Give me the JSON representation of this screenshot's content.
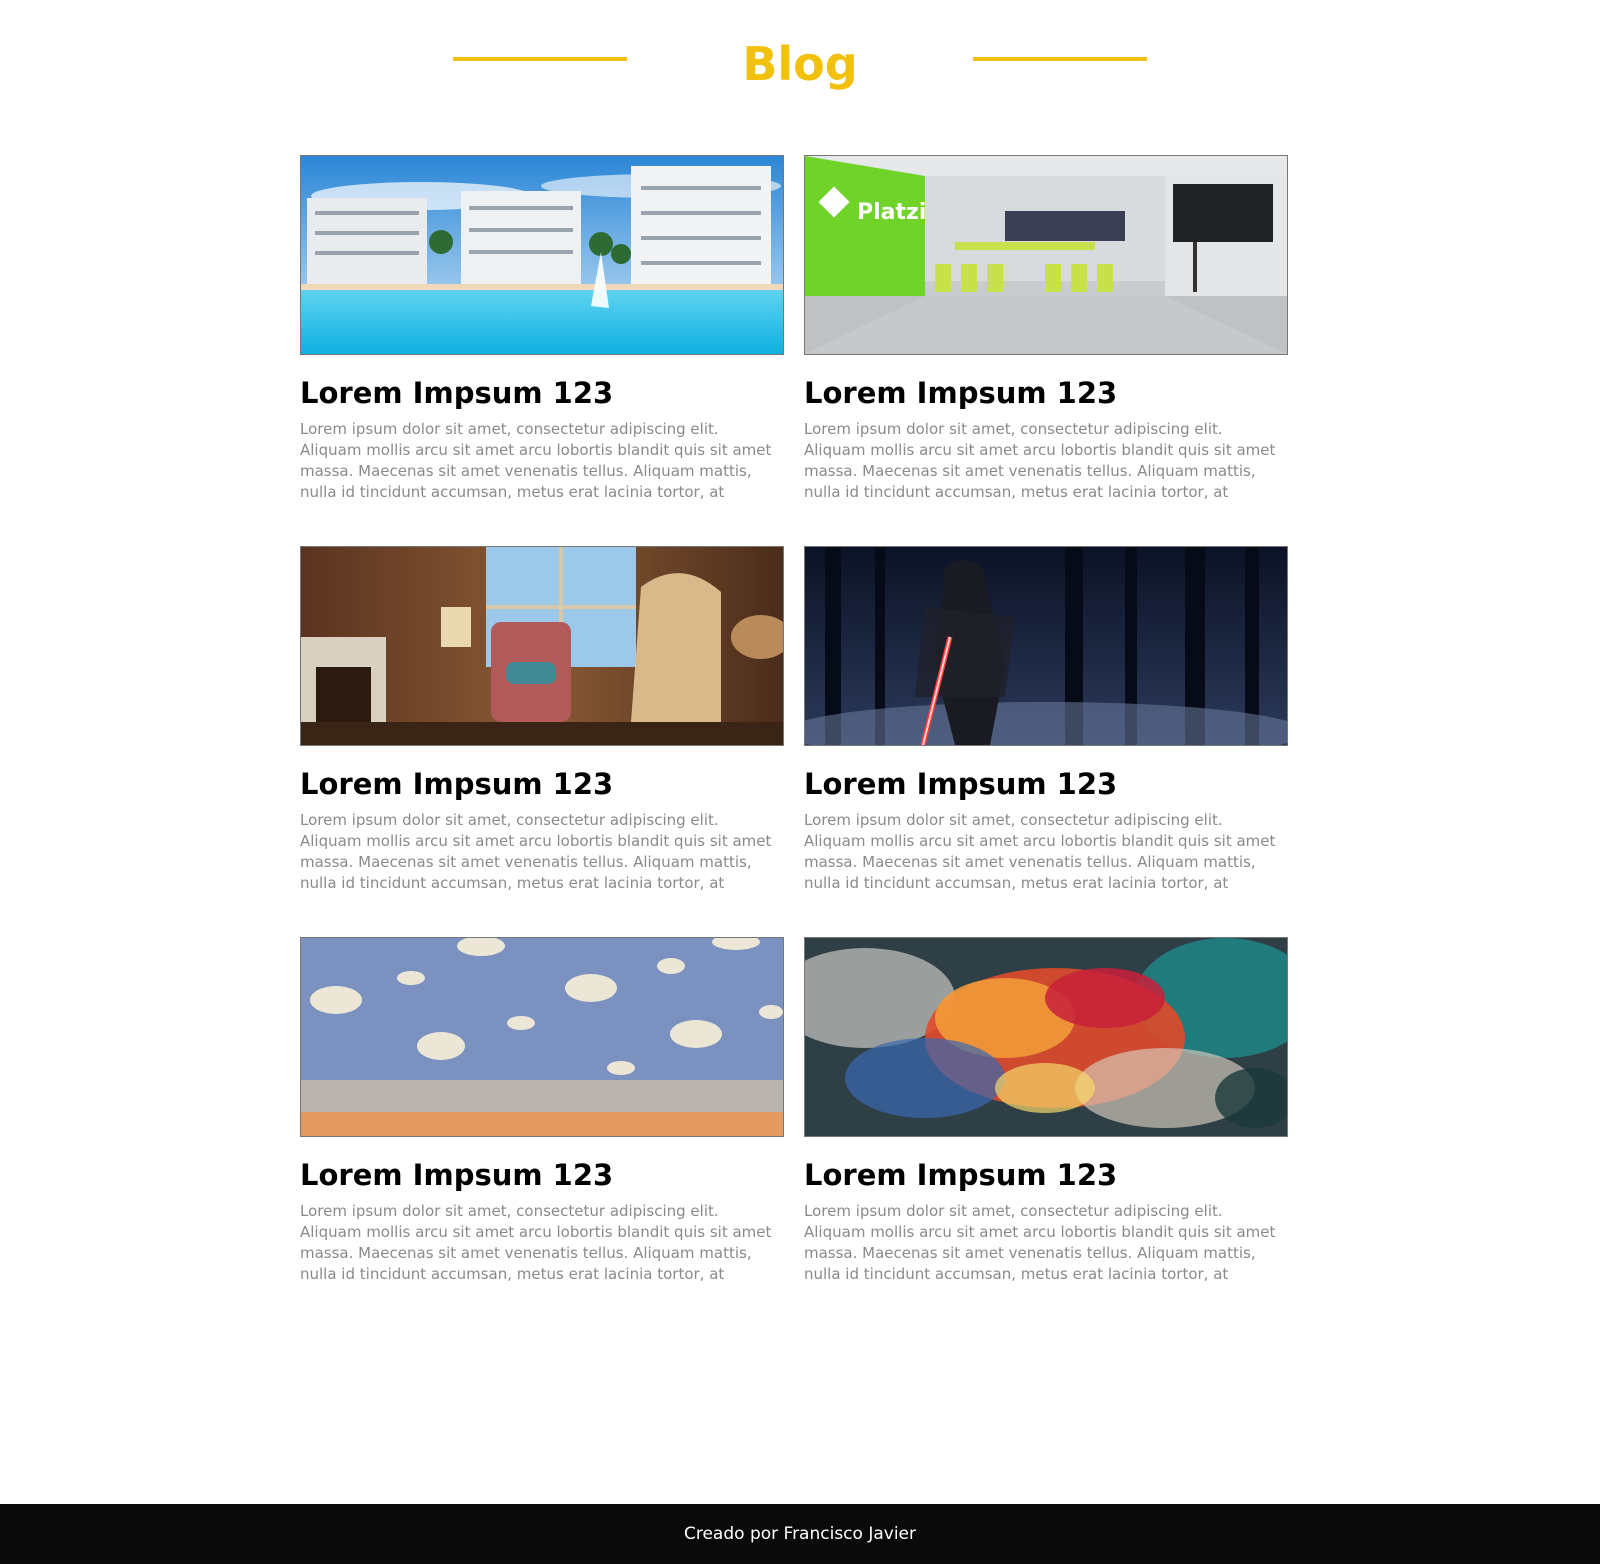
{
  "header": {
    "title": "Blog"
  },
  "colors": {
    "accent": "#f2c10c",
    "footer_bg": "#0a0a0a",
    "excerpt_text": "#8a8a8a"
  },
  "posts": [
    {
      "image": "resort-pool-buildings",
      "title": "Lorem Impsum 123",
      "excerpt": "Lorem ipsum dolor sit amet, consectetur adipiscing elit. Aliquam mollis arcu sit amet arcu lobortis blandit quis sit amet massa. Maecenas sit amet venenatis tellus. Aliquam mattis, nulla id tincidunt accumsan, metus erat lacinia tortor, at sodales lorem"
    },
    {
      "image": "platzi-classroom",
      "image_text": "Platzi",
      "title": "Lorem Impsum 123",
      "excerpt": "Lorem ipsum dolor sit amet, consectetur adipiscing elit. Aliquam mollis arcu sit amet arcu lobortis blandit quis sit amet massa. Maecenas sit amet venenatis tellus. Aliquam mattis, nulla id tincidunt accumsan, metus erat lacinia tortor, at sodales lorem"
    },
    {
      "image": "cozy-living-room",
      "title": "Lorem Impsum 123",
      "excerpt": "Lorem ipsum dolor sit amet, consectetur adipiscing elit. Aliquam mollis arcu sit amet arcu lobortis blandit quis sit amet massa. Maecenas sit amet venenatis tellus. Aliquam mattis, nulla id tincidunt accumsan, metus erat lacinia tortor, at sodales lorem"
    },
    {
      "image": "dark-forest-lightsaber",
      "title": "Lorem Impsum 123",
      "excerpt": "Lorem ipsum dolor sit amet, consectetur adipiscing elit. Aliquam mollis arcu sit amet arcu lobortis blandit quis sit amet massa. Maecenas sit amet venenatis tellus. Aliquam mattis, nulla id tincidunt accumsan, metus erat lacinia tortor, at sodales lorem"
    },
    {
      "image": "cloud-wallpaper-room",
      "title": "Lorem Impsum 123",
      "excerpt": "Lorem ipsum dolor sit amet, consectetur adipiscing elit. Aliquam mollis arcu sit amet arcu lobortis blandit quis sit amet massa. Maecenas sit amet venenatis tellus. Aliquam mattis, nulla id tincidunt accumsan, metus erat lacinia tortor, at sodales lorem"
    },
    {
      "image": "colorful-paint-explosion",
      "title": "Lorem Impsum 123",
      "excerpt": "Lorem ipsum dolor sit amet, consectetur adipiscing elit. Aliquam mollis arcu sit amet arcu lobortis blandit quis sit amet massa. Maecenas sit amet venenatis tellus. Aliquam mattis, nulla id tincidunt accumsan, metus erat lacinia tortor, at sodales lorem"
    }
  ],
  "footer": {
    "text": "Creado por Francisco Javier"
  }
}
